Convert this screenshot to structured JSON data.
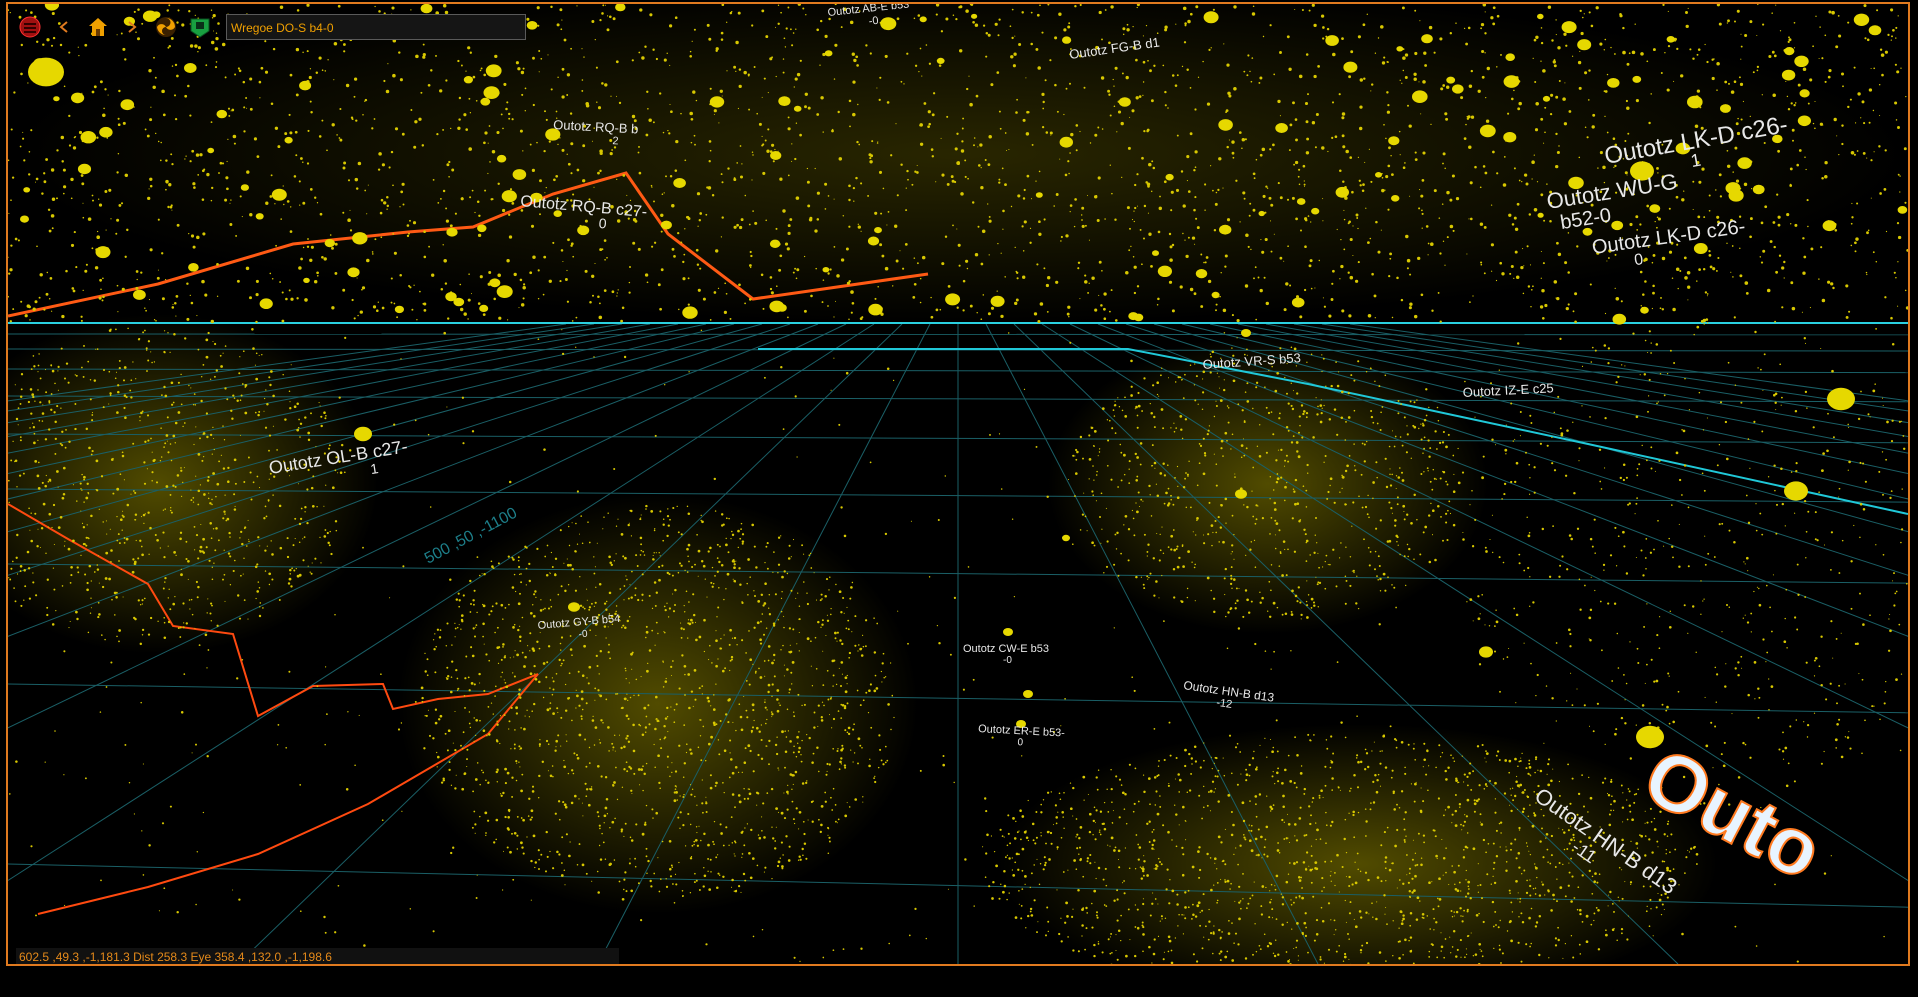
{
  "toolbar": {
    "icons": [
      "menu-icon",
      "back-icon",
      "home-icon",
      "forward-icon",
      "galaxy-icon",
      "map-icon"
    ],
    "title": "Wregoe DO-S b4-0"
  },
  "status": {
    "readout": "602.5 ,49.3 ,-1,181.3 Dist 258.3 Eye 358.4 ,132.0 ,-1,198.6"
  },
  "labels": [
    {
      "text": "Outotz AB-E b53",
      "sub": "-0"
    },
    {
      "text": "Outotz FG-B d1",
      "sub": ""
    },
    {
      "text": "Outotz LK-D c26-",
      "sub": "1"
    },
    {
      "text": "Outotz WU-G",
      "sub": "b52-0"
    },
    {
      "text": "Outotz LK-D c26-",
      "sub": "0"
    },
    {
      "text": "Outotz RQ-B c27-",
      "sub": "0"
    },
    {
      "text": "Outotz RQ-B b",
      "sub": "2"
    },
    {
      "text": "Outotz OL-B c27-",
      "sub": "1"
    },
    {
      "text": "Outotz VR-S b53",
      "sub": ""
    },
    {
      "text": "Outotz IZ-E c25",
      "sub": ""
    },
    {
      "text": "Outotz CW-E b53",
      "sub": "-0"
    },
    {
      "text": "Outotz HN-B d13",
      "sub": "-12"
    },
    {
      "text": "Outotz ER-E b53-",
      "sub": "0"
    },
    {
      "text": "Outotz GY-B b54",
      "sub": "-0"
    },
    {
      "text": "Outotz HN-B d13",
      "sub": "-11"
    },
    {
      "text": "Outo",
      "sub": ""
    },
    {
      "text": "500 ,50 ,-1100",
      "sub": ""
    }
  ]
}
